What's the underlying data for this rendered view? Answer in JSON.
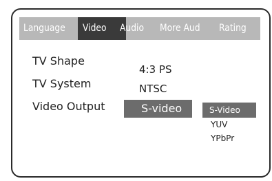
{
  "tabs": {
    "language": "Language",
    "video": "Video",
    "audio": "Audio",
    "more_aud": "More Aud",
    "rating": "Rating",
    "selected": "Video"
  },
  "settings": {
    "tv_shape": {
      "label": "TV Shape",
      "value": "4:3 PS"
    },
    "tv_system": {
      "label": "TV System",
      "value": "NTSC"
    },
    "video_output": {
      "label": "Video Output",
      "value": "S-video"
    }
  },
  "video_output_options": {
    "items": [
      "S-Video",
      "YUV",
      "YPbPr"
    ],
    "selected": "S-Video"
  },
  "colors": {
    "tab_bar": "#b8b8b8",
    "tab_selected": "#3a3a3a",
    "value_highlight": "#6c6c6c",
    "tab_text": "#ffffff",
    "body_text": "#222222"
  }
}
